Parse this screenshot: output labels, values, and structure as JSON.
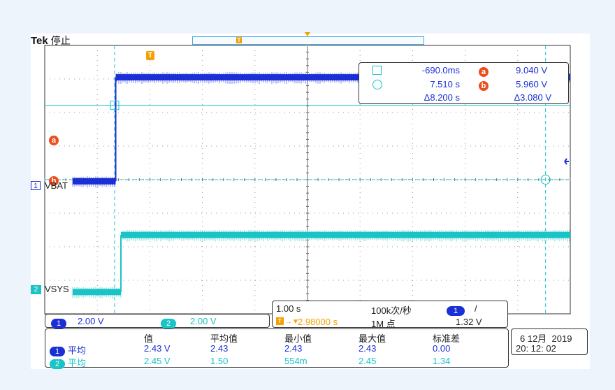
{
  "header": {
    "brand": "Tek",
    "state": "停止"
  },
  "trigger_marker": "T",
  "cursor_readout": {
    "row1": {
      "time": "-690.0ms",
      "volt": "9.040 V"
    },
    "row2": {
      "time": "7.510 s",
      "volt": "5.960 V"
    },
    "delta": {
      "time": "Δ8.200 s",
      "volt": "Δ3.080 V"
    },
    "cursor_a_label": "a",
    "cursor_b_label": "b"
  },
  "channels": {
    "ch1": {
      "number": "1",
      "label": "VBAT",
      "scale": "2.00 V",
      "color": "#1a2fd6"
    },
    "ch2": {
      "number": "2",
      "label": "VSYS",
      "scale": "2.00 V",
      "color": "#19c3c6"
    }
  },
  "timebase": {
    "scale": "1.00 s",
    "trigger_pos": "2.98000 s",
    "sample_rate": "100k次/秒",
    "record_length": "1M 点",
    "trigger_channel": "1",
    "trigger_slope": "/",
    "trigger_level": "1.32 V"
  },
  "measurements": {
    "headers": [
      "值",
      "平均值",
      "最小值",
      "最大值",
      "标准差"
    ],
    "rows": [
      {
        "channel": "1",
        "type": "平均",
        "value": "2.43 V",
        "mean": "2.43",
        "min": "2.43",
        "max": "2.43",
        "std": "0.00"
      },
      {
        "channel": "2",
        "type": "平均",
        "value": "2.45 V",
        "mean": "1.50",
        "min": "554m",
        "max": "2.45",
        "std": "1.34"
      }
    ]
  },
  "datetime": {
    "date": "6 12月  2019",
    "time": "20: 12: 02"
  },
  "colors": {
    "trigger": "#f5a000",
    "cursor": "#19c3c6",
    "cursor_label": "#e8501e",
    "ch1": "#1a2fd6",
    "ch2": "#19c3c6"
  },
  "waveforms": {
    "ch1": {
      "before_divs": -0.05,
      "after_divs": 3.05,
      "step_time_div": 1.35
    },
    "ch2": {
      "before_divs": -1.9,
      "after_divs": 1.0,
      "step_time_div": 1.45
    }
  }
}
